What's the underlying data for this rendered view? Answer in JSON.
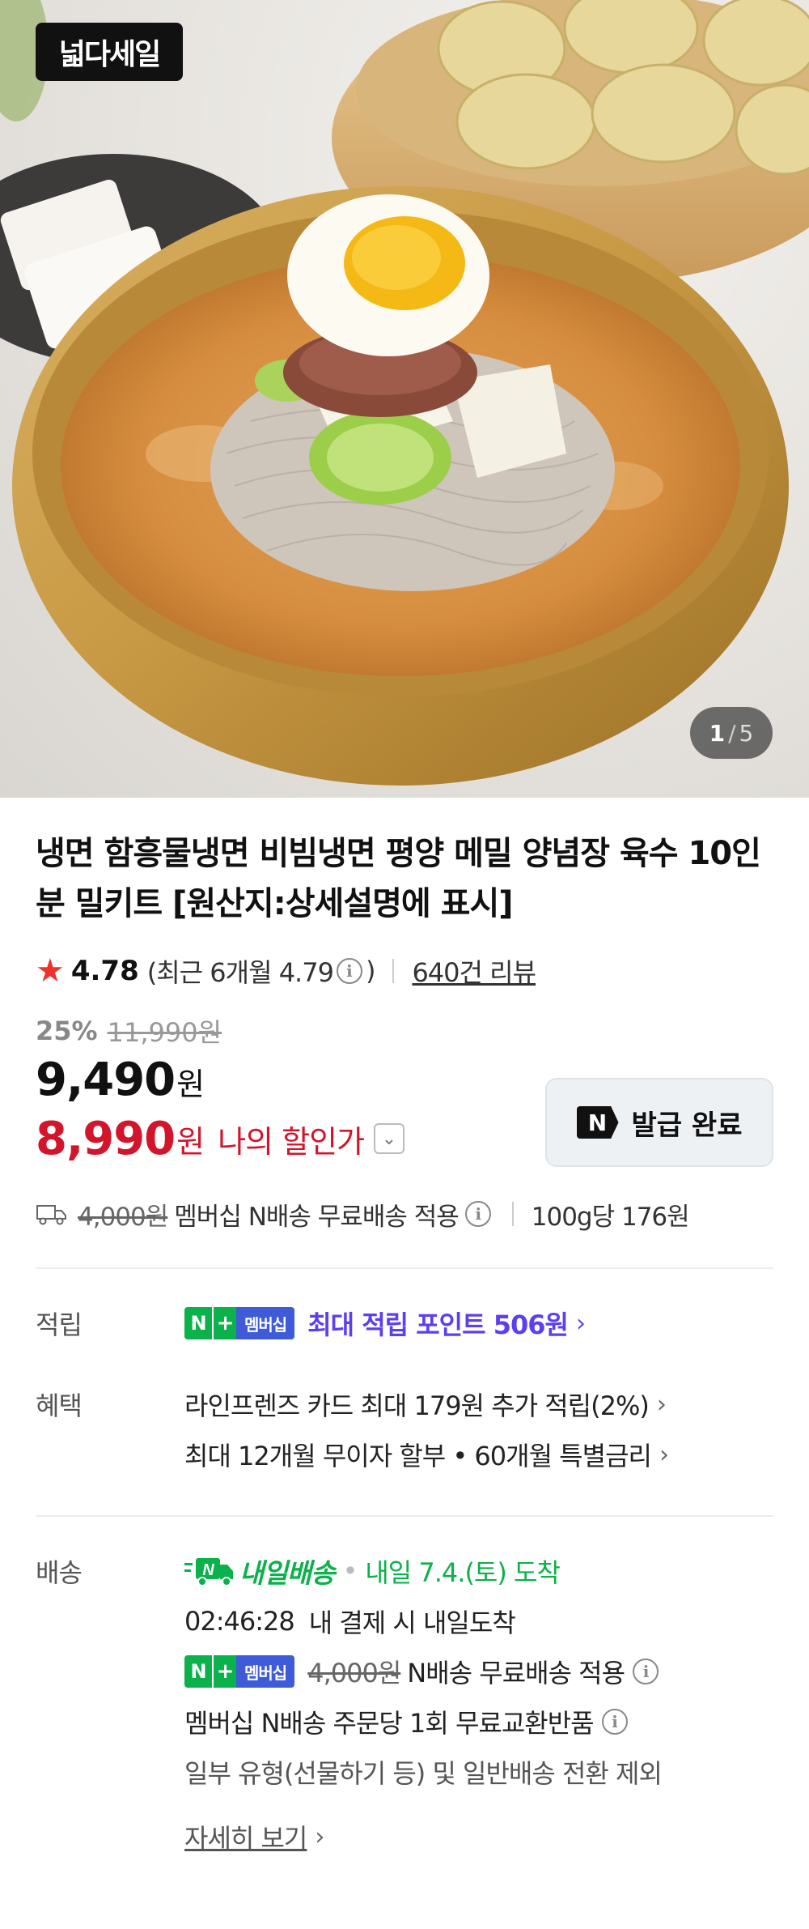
{
  "hero": {
    "brand_badge": "넓다세일",
    "pager_current": "1",
    "pager_separator": "/",
    "pager_total": "5"
  },
  "product": {
    "title": "냉면 함흥물냉면 비빔냉면 평양 메밀 양념장 육수 10인분 밀키트 [원산지:상세설명에 표시]",
    "rating": "4.78",
    "recent_rating": "(최근 6개월 4.79",
    "recent_close": ")",
    "review_count": "640건 리뷰"
  },
  "price": {
    "discount_rate": "25%",
    "original_price": "11,990원",
    "sale_price": "9,490",
    "sale_unit": "원",
    "my_price": "8,990",
    "my_unit": "원",
    "my_label": "나의 할인가",
    "coupon_label": "발급 완료",
    "coupon_logo": "N"
  },
  "shipping_summary": {
    "fee": "4,000원",
    "free_text": "멤버십 N배송 무료배송 적용",
    "unit_price": "100g당 176원"
  },
  "points": {
    "label": "적립",
    "badge_n": "N",
    "badge_plus": "+",
    "badge_member": "멤버십",
    "text": "최대 적립 포인트 506원"
  },
  "benefits": {
    "label": "혜택",
    "items": [
      "라인프렌즈 카드 최대 179원 추가 적립(2%)",
      "최대 12개월 무이자 할부 • 60개월 특별금리"
    ]
  },
  "delivery": {
    "label": "배송",
    "badge_text": "내일배송",
    "arrival": "내일 7.4.(토) 도착",
    "countdown": "02:46:28",
    "countdown_text": "내 결제 시 내일도착",
    "fee": "4,000원",
    "free_text": "N배송 무료배송 적용",
    "exchange_text": "멤버십 N배송 주문당 1회 무료교환반품",
    "exclusion_text": "일부 유형(선물하기 등) 및 일반배송 전환 제외",
    "detail_link": "자세히 보기"
  },
  "colors": {
    "accent_red": "#d2152b",
    "naver_green": "#0bb14a",
    "points_purple": "#5b3ff0",
    "membership_blue": "#3f5bd8"
  }
}
